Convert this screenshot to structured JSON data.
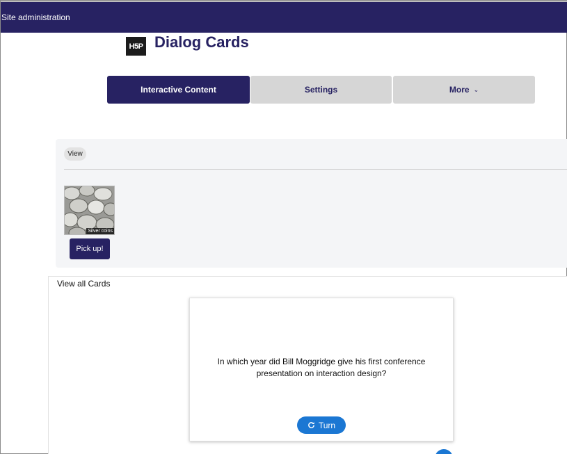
{
  "topbar": {
    "title": "Site administration"
  },
  "header": {
    "logo_text": "H5P",
    "title": "Dialog Cards"
  },
  "tabs": [
    {
      "label": "Interactive Content",
      "active": true
    },
    {
      "label": "Settings",
      "active": false
    },
    {
      "label": "More",
      "active": false
    }
  ],
  "panel": {
    "view_label": "View",
    "image_caption": "Silver coins",
    "pickup_label": "Pick up!"
  },
  "cards": {
    "heading": "View all Cards",
    "card_text": "In which year did Bill Moggridge give his first conference presentation on interaction design?",
    "turn_label": "Turn"
  },
  "colors": {
    "brand": "#272262",
    "accent": "#1b77d3",
    "tab_inactive": "#d6d6d6"
  }
}
